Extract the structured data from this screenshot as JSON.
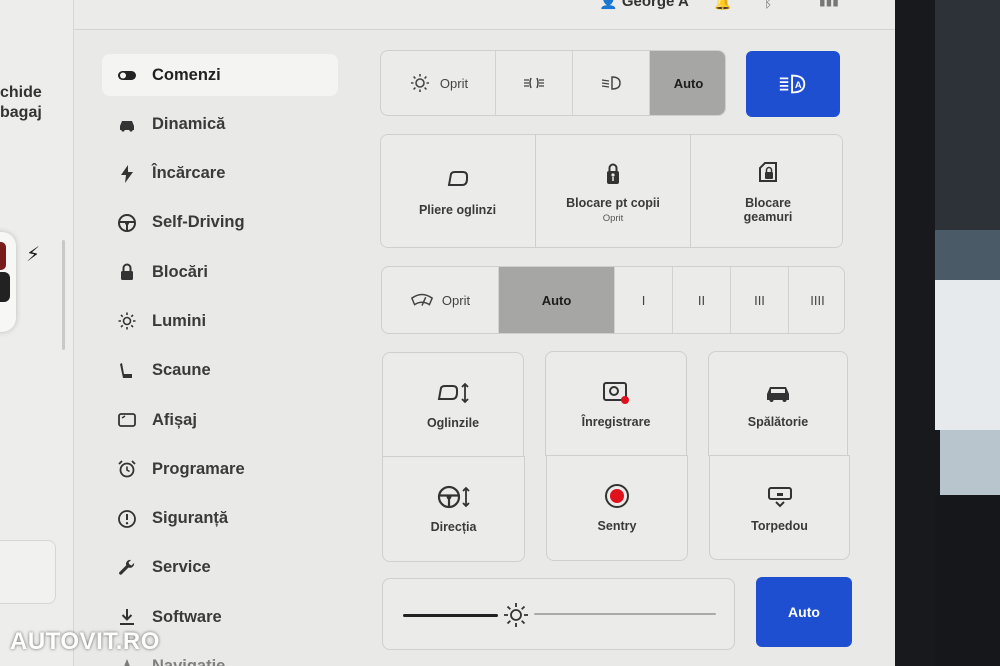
{
  "topbar": {
    "user_name": "George A"
  },
  "left_panel": {
    "text_line1": "chide",
    "text_line2": "bagaj"
  },
  "menu": {
    "items": [
      {
        "label": "Comenzi",
        "icon": "toggle-icon",
        "active": true
      },
      {
        "label": "Dinamică",
        "icon": "car-icon"
      },
      {
        "label": "Încărcare",
        "icon": "bolt-icon"
      },
      {
        "label": "Self-Driving",
        "icon": "steering-wheel-icon"
      },
      {
        "label": "Blocări",
        "icon": "lock-icon"
      },
      {
        "label": "Lumini",
        "icon": "sun-icon"
      },
      {
        "label": "Scaune",
        "icon": "seat-icon"
      },
      {
        "label": "Afișaj",
        "icon": "display-icon"
      },
      {
        "label": "Programare",
        "icon": "alarm-clock-icon"
      },
      {
        "label": "Siguranță",
        "icon": "alert-circle-icon"
      },
      {
        "label": "Service",
        "icon": "wrench-icon"
      },
      {
        "label": "Software",
        "icon": "download-icon"
      },
      {
        "label": "Navigatie",
        "icon": "navigation-icon"
      }
    ]
  },
  "lights": {
    "off_label": "Oprit",
    "auto_label": "Auto",
    "selected": "Auto"
  },
  "toggles": {
    "fold_mirrors": "Pliere oglinzi",
    "child_lock": "Blocare pt copii",
    "child_lock_status": "Oprit",
    "window_lock_line1": "Blocare",
    "window_lock_line2": "geamuri"
  },
  "wipers": {
    "off_label": "Oprit",
    "auto_label": "Auto",
    "speeds": [
      "I",
      "II",
      "III",
      "IIII"
    ],
    "selected": "Auto"
  },
  "controls": {
    "mirrors": "Oglinzile",
    "recording": "Înregistrare",
    "car_wash": "Spălătorie",
    "steering": "Direcția",
    "sentry": "Sentry",
    "glovebox": "Torpedou"
  },
  "brightness": {
    "auto_label": "Auto",
    "level": 0.36
  },
  "colors": {
    "accent_blue": "#1f4fd1",
    "record_red": "#e0111c",
    "selected_gray": "#a6a6a4"
  },
  "watermark": "AUTOVIT.RO"
}
